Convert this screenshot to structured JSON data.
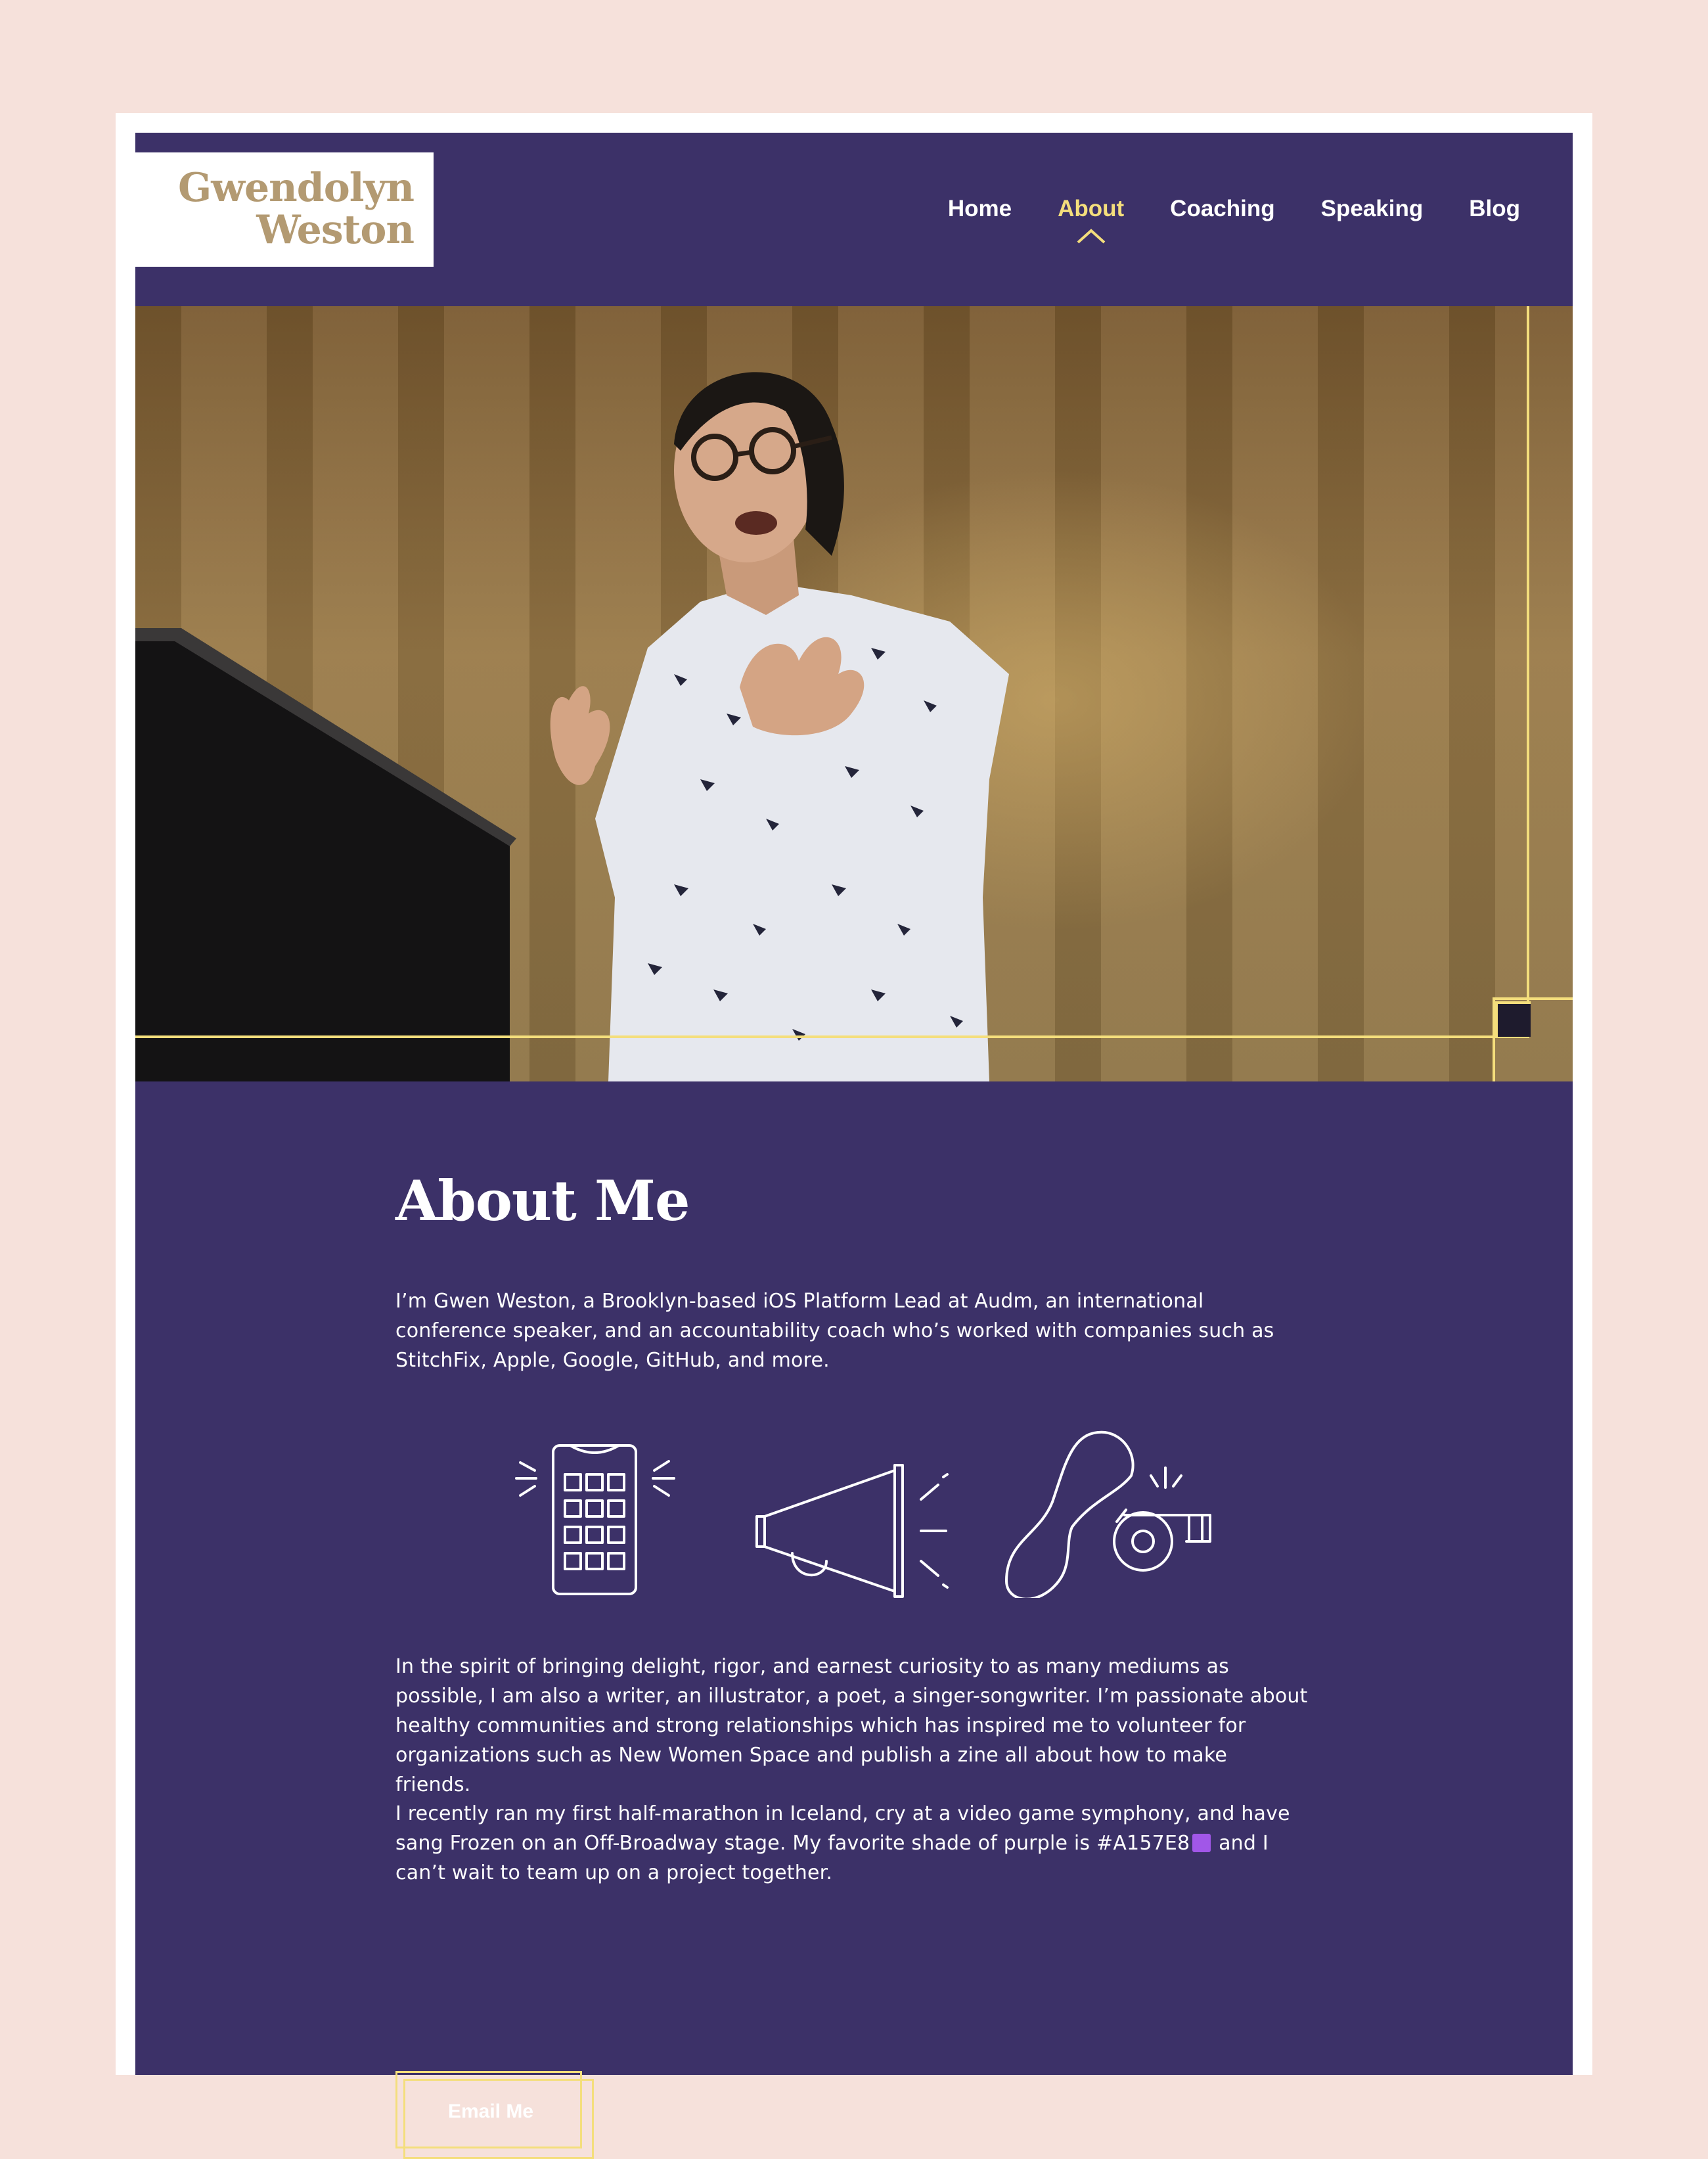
{
  "site": {
    "logo_line1": "Gwendolyn",
    "logo_line2": "Weston"
  },
  "nav": {
    "items": [
      {
        "label": "Home"
      },
      {
        "label": "About"
      },
      {
        "label": "Coaching"
      },
      {
        "label": "Speaking"
      },
      {
        "label": "Blog"
      }
    ],
    "active": "About"
  },
  "hero": {
    "image": "photo of a speaker presenting at a podium"
  },
  "about": {
    "heading": "About Me",
    "paragraph1": "I’m Gwen Weston, a Brooklyn-based iOS Platform Lead at Audm, an international conference speaker, and an accountability coach who’s worked with companies such as StitchFix, Apple, Google, GitHub, and more.",
    "icons": [
      "phone-icon",
      "megaphone-icon",
      "whistle-icon"
    ],
    "paragraph2": "In the spirit of bringing delight, rigor, and earnest curiosity to as many mediums as possible, I am also a writer, an illustrator, a poet, a singer-songwriter. I’m passionate about healthy communities and strong relationships which has inspired me to volunteer for organizations such as New Women Space and publish a zine all about how to make friends.",
    "paragraph3_before": "I recently ran my first half-marathon in Iceland, cry at a video game symphony, and have sang Frozen on an Off-Broadway stage. My favorite shade of purple is #A157E8",
    "paragraph3_after": " and I can’t wait to team up on a project together.",
    "swatch_color": "#A157E8",
    "cta_label": "Email Me"
  },
  "colors": {
    "page_bg": "#F6E1DB",
    "site_bg": "#3C3168",
    "accent_yellow": "#F4DE7C",
    "logo_tan": "#B39A72"
  }
}
